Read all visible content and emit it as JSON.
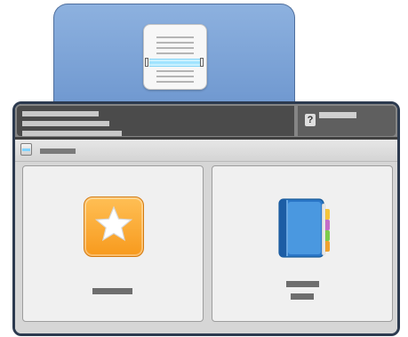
{
  "window": {
    "title": ""
  },
  "top_tab": {
    "icon": "scanner-document-icon"
  },
  "status_bar": {
    "lines": [
      "",
      "",
      ""
    ],
    "login_label": "",
    "login_icon": "?"
  },
  "section": {
    "title": "",
    "icon": "document-icon"
  },
  "tiles": [
    {
      "icon": "favorite-star-icon",
      "label": ""
    },
    {
      "icon": "address-book-icon",
      "label_line_1": "",
      "label_line_2": ""
    }
  ],
  "colors": {
    "tab_blue": "#7ca3d8",
    "panel_border": "#2c3a4f",
    "status_dark": "#4b4b4b",
    "star_orange": "#f79a1d",
    "book_blue": "#2f7fd1"
  }
}
